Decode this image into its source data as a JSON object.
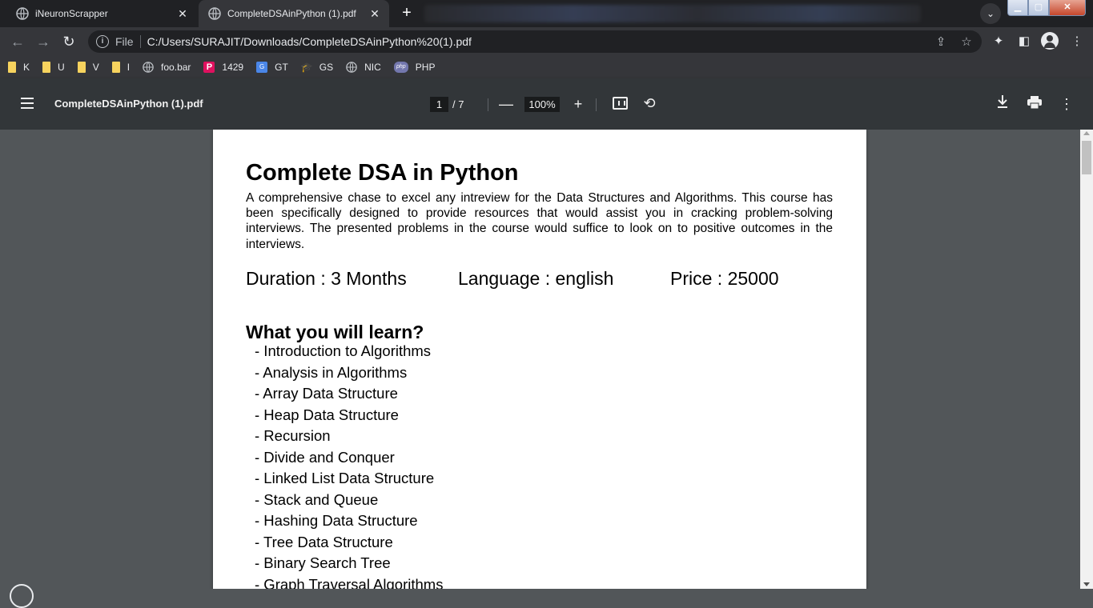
{
  "browser": {
    "tabs": [
      {
        "title": "iNeuronScrapper",
        "active": false
      },
      {
        "title": "CompleteDSAinPython (1).pdf",
        "active": true
      }
    ],
    "new_tab_icon": "+",
    "address": {
      "scheme_label": "File",
      "url": "C:/Users/SURAJIT/Downloads/CompleteDSAinPython%20(1).pdf"
    },
    "bookmarks": [
      {
        "label": "K",
        "icon": "folder-icon"
      },
      {
        "label": "U",
        "icon": "folder-icon"
      },
      {
        "label": "V",
        "icon": "folder-icon"
      },
      {
        "label": "I",
        "icon": "folder-icon"
      },
      {
        "label": "foo.bar",
        "icon": "globe-icon"
      },
      {
        "label": "1429",
        "icon": "p-icon"
      },
      {
        "label": "GT",
        "icon": "translate-icon"
      },
      {
        "label": "GS",
        "icon": "scholar-icon"
      },
      {
        "label": "NIC",
        "icon": "globe-icon"
      },
      {
        "label": "PHP",
        "icon": "php-icon"
      }
    ],
    "bookmark_icon_text": {
      "p": "P",
      "gt": "G",
      "gs": "🎓",
      "php": "php"
    }
  },
  "pdf_toolbar": {
    "file_name": "CompleteDSAinPython (1).pdf",
    "current_page": "1",
    "total_pages": "/ 7",
    "zoom": "100%",
    "zoom_out": "—",
    "zoom_in": "+"
  },
  "document": {
    "title": "Complete DSA in Python",
    "description": "A comprehensive chase to excel any intreview for the Data Structures and Algorithms. This course has been specifically designed to provide resources that would assist you in cracking problem-solving interviews. The presented problems in the course would suffice to look on to positive outcomes in the interviews.",
    "duration": "Duration : 3 Months",
    "language": "Language : english",
    "price": "Price : 25000",
    "learn_heading": "What you will learn?",
    "topics": [
      "- Introduction to Algorithms",
      "- Analysis in Algorithms",
      "- Array Data Structure",
      "- Heap Data Structure",
      "- Recursion",
      "- Divide and Conquer",
      "- Linked List Data Structure",
      "- Stack and Queue",
      "- Hashing Data Structure",
      "- Tree Data Structure",
      "- Binary Search Tree",
      "- Graph Traversal Algorithms"
    ]
  }
}
